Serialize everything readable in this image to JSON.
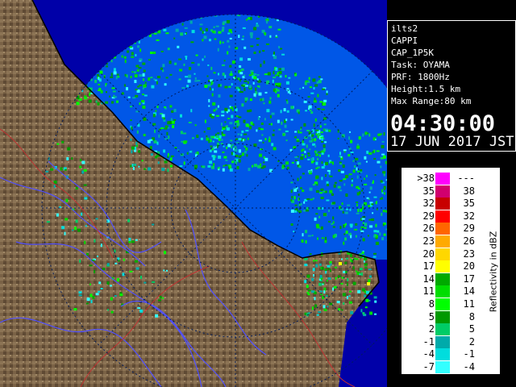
{
  "info": {
    "station": "ilts2",
    "product": "CAPPI",
    "mode": "CAP_1P5K",
    "task": "Task: OYAMA",
    "prf": "PRF: 1800Hz",
    "height": "Height:1.5 km",
    "max_range": "Max Range:80 km",
    "time": "04:30:00",
    "date": "17 JUN 2017 JST"
  },
  "legend": {
    "title": "Reflectivity in dBZ",
    "rows": [
      {
        "lo": ">38",
        "hi": "---",
        "color": "#ff00ff"
      },
      {
        "lo": "35",
        "hi": "38",
        "color": "#d1006f"
      },
      {
        "lo": "32",
        "hi": "35",
        "color": "#c80000"
      },
      {
        "lo": "29",
        "hi": "32",
        "color": "#ff0000"
      },
      {
        "lo": "26",
        "hi": "29",
        "color": "#ff6600"
      },
      {
        "lo": "23",
        "hi": "26",
        "color": "#ffaa00"
      },
      {
        "lo": "20",
        "hi": "23",
        "color": "#ffd700"
      },
      {
        "lo": "17",
        "hi": "20",
        "color": "#ffff00"
      },
      {
        "lo": "14",
        "hi": "17",
        "color": "#00aa00"
      },
      {
        "lo": "11",
        "hi": "14",
        "color": "#00dd00"
      },
      {
        "lo": "8",
        "hi": "11",
        "color": "#00ff00"
      },
      {
        "lo": "5",
        "hi": "8",
        "color": "#009900"
      },
      {
        "lo": "2",
        "hi": "5",
        "color": "#00cc66"
      },
      {
        "lo": "-1",
        "hi": "2",
        "color": "#00aaaa"
      },
      {
        "lo": "-4",
        "hi": "-1",
        "color": "#00dddd"
      },
      {
        "lo": "-7",
        "hi": "-4",
        "color": "#33ffff"
      }
    ]
  },
  "colors": {
    "ocean": "#0057e7",
    "outside": "#0000a8",
    "land": "#7a6246",
    "rivers": "#5050ff",
    "borders": "#c03030",
    "range_rings": "#001b5a"
  },
  "map": {
    "max_range_km": 80
  }
}
